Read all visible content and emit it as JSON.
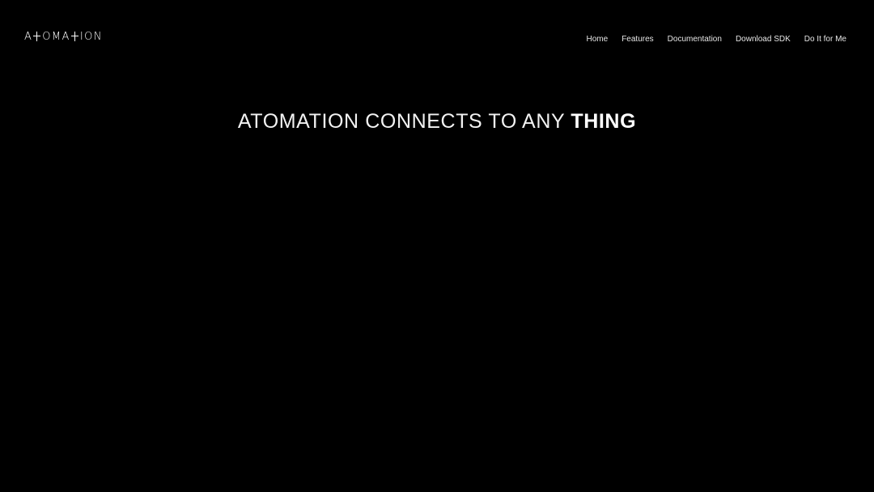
{
  "logo": {
    "text_a": "A",
    "text_oma": "OMA",
    "text_ion": "ION"
  },
  "nav": {
    "items": [
      {
        "label": "Home"
      },
      {
        "label": "Features"
      },
      {
        "label": "Documentation"
      },
      {
        "label": "Download SDK"
      },
      {
        "label": "Do It for Me"
      }
    ]
  },
  "hero": {
    "headline_light": "ATOMATION CONNECTS TO ANY ",
    "headline_bold": "THING"
  },
  "colors": {
    "background": "#000000",
    "text": "#ffffff"
  }
}
